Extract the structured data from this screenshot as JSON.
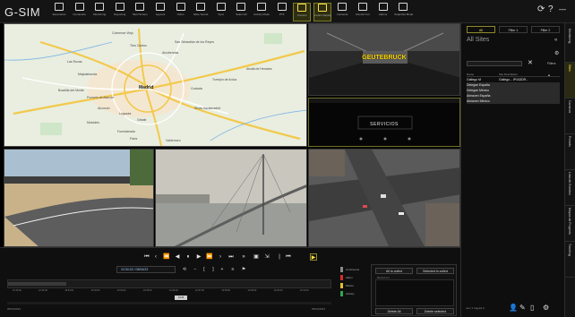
{
  "app": {
    "logo": "G-SIM"
  },
  "toolbar": {
    "buttons": [
      {
        "label": "Escenarios",
        "icon": "scenarios-icon"
      },
      {
        "label": "Comandos",
        "icon": "commands-icon"
      },
      {
        "label": "Monitoring",
        "icon": "monitoring-icon"
      },
      {
        "label": "Reporting",
        "icon": "reporting-icon"
      },
      {
        "label": "Multi Screen",
        "icon": "multi-screen-icon"
      },
      {
        "label": "Layouts",
        "icon": "layouts-icon"
      },
      {
        "label": "Vídeo",
        "icon": "video-icon"
      },
      {
        "label": "Mute Sound",
        "icon": "mute-sound-icon"
      },
      {
        "label": "Sync",
        "icon": "sync-icon"
      },
      {
        "label": "Select All",
        "icon": "select-all-icon"
      },
      {
        "label": "Activity Mode",
        "icon": "activity-mode-icon"
      },
      {
        "label": "PTZ",
        "icon": "ptz-icon"
      },
      {
        "label": "Preview",
        "icon": "preview-icon"
      },
      {
        "label": "Instant Replay",
        "icon": "instant-replay-icon"
      },
      {
        "label": "Cameras",
        "icon": "cameras-icon"
      },
      {
        "label": "Record Cut",
        "icon": "record-cut-icon"
      },
      {
        "label": "Alarms",
        "icon": "alarms-icon"
      },
      {
        "label": "Snapshot Mode",
        "icon": "snapshot-mode-icon"
      }
    ],
    "right": {
      "options_label": "Options",
      "help_label": "Help"
    }
  },
  "tiles": {
    "map": {
      "labels": [
        "Madrid",
        "Pozuelo de Alarcón",
        "Alcobendas",
        "San Sebastián de los Reyes",
        "Getafe",
        "Leganés",
        "Móstoles",
        "Alcorcón",
        "Fuenlabrada",
        "Majadahonda",
        "Las Rozas",
        "Torrejón de Ardoz",
        "Coslada",
        "Rivas-Vaciamadrid",
        "Parla",
        "Valdemoro",
        "Boadilla del Monte",
        "Tres Cantos",
        "Colmenar Viejo",
        "Alcalá de Henares"
      ]
    },
    "cam1": {
      "overlay": "GEUTEBRUCK"
    },
    "cam2": {
      "overlay": "SERVICIOS"
    }
  },
  "right_panel": {
    "tabs": [
      "All",
      "Filter 1",
      "Filter 2"
    ],
    "active_tab": "All",
    "title": "All Sites",
    "search": {
      "value": "",
      "placeholder": ""
    },
    "filters_label": "Filters",
    "columns": [
      "Name",
      "Site Description"
    ],
    "rows": [
      {
        "name": "Gallego M",
        "desc": "Gallego... IP/ADDR..."
      },
      {
        "name": "Delegan España",
        "desc": ""
      },
      {
        "name": "Delegan México",
        "desc": ""
      },
      {
        "name": "Almacen España",
        "desc": ""
      },
      {
        "name": "Almacen México",
        "desc": ""
      }
    ]
  },
  "side_tabs": [
    "Monitoring",
    "Sites",
    "Cameras",
    "Presets",
    "Lista de Eventos",
    "Mapas de Proyecto",
    "Ticketing"
  ],
  "playback": {
    "time": "10:34:23 / 05/04/23",
    "ticks": [
      "10:30:00",
      "10:31:00",
      "10:32:00",
      "10:33:00",
      "10:34:00",
      "10:35:00",
      "10:36:00",
      "10:37:00",
      "10:38:00",
      "10:39:00",
      "10:40:00",
      "10:41:00"
    ],
    "marker": "10:34",
    "date_left": "05/04/2023",
    "date_right": "05/04/2023",
    "progress": 0.18
  },
  "legend": [
    {
      "label": "Continuous",
      "color": "#8a8a8a"
    },
    {
      "label": "Alarm",
      "color": "#d92b2b"
    },
    {
      "label": "Motion",
      "color": "#e0c326"
    },
    {
      "label": "Activity",
      "color": "#2fa84f"
    }
  ],
  "cull": {
    "add_all": "All to culled",
    "add_selected": "Selected to culled",
    "description": "Record cut",
    "delete_all": "Delete All",
    "delete_selected": "Delete selected"
  },
  "status": {
    "text": "user 1 logged in"
  }
}
